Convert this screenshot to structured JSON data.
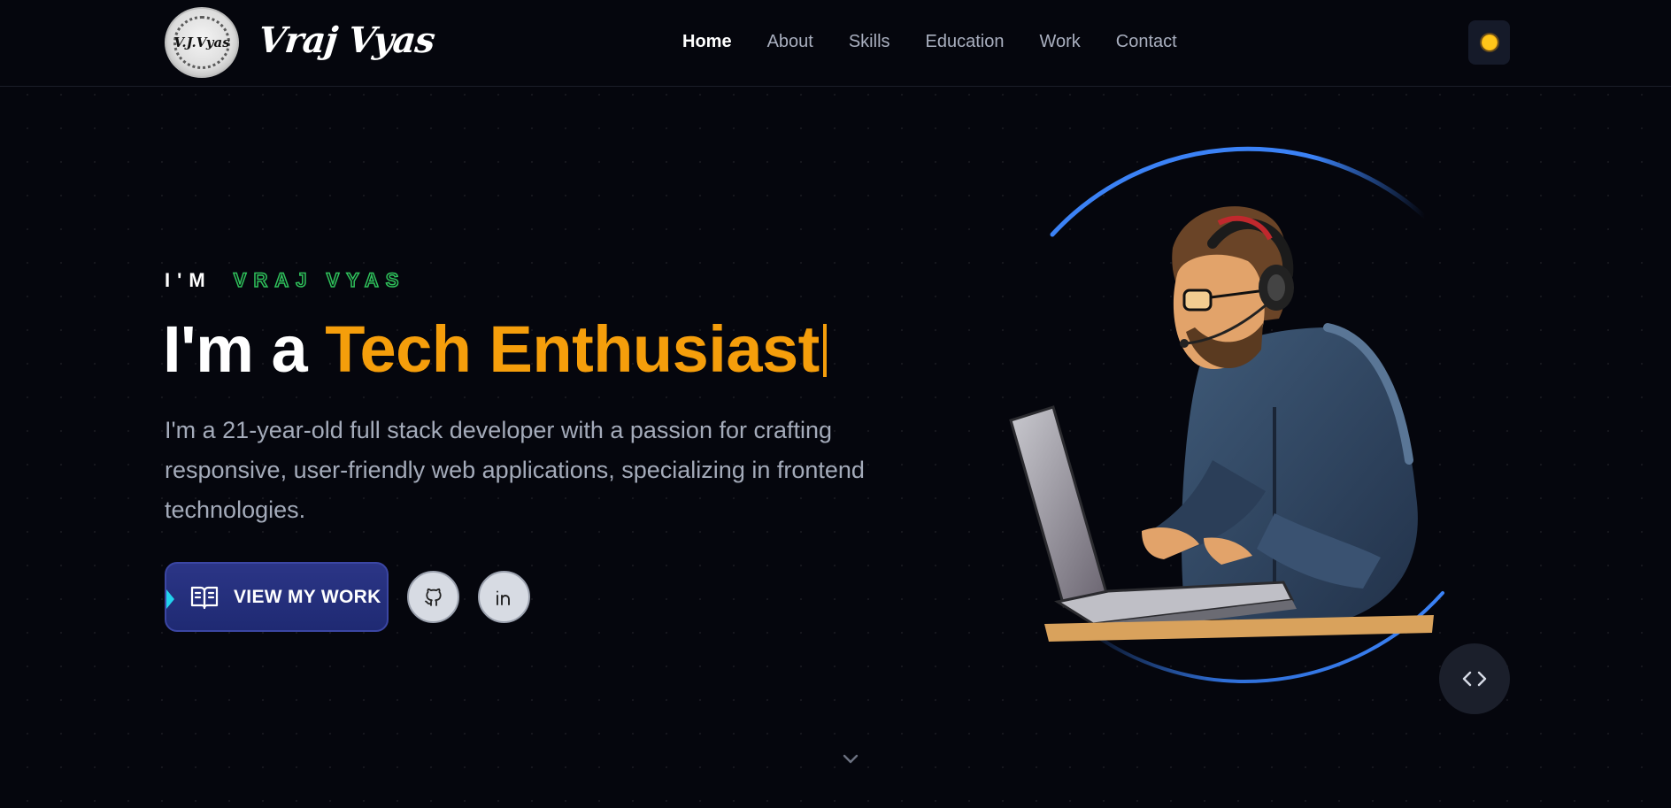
{
  "brand": {
    "monogram": "V.J.Vyas",
    "name": "Vraj Vyas"
  },
  "nav": {
    "items": [
      {
        "label": "Home",
        "active": true
      },
      {
        "label": "About",
        "active": false
      },
      {
        "label": "Skills",
        "active": false
      },
      {
        "label": "Education",
        "active": false
      },
      {
        "label": "Work",
        "active": false
      },
      {
        "label": "Contact",
        "active": false
      }
    ],
    "theme_icon": "sun-icon"
  },
  "hero": {
    "eyebrow_prefix": "I'M",
    "eyebrow_name": "VRAJ VYAS",
    "headline_prefix": "I'm a",
    "headline_role": "Tech Enthusiast",
    "intro": "I'm a 21-year-old full stack developer with a passion for crafting responsive, user-friendly web applications, specializing in frontend technologies.",
    "cta_label": "VIEW MY WORK",
    "cta_icon": "open-book-icon",
    "socials": [
      {
        "name": "github-icon"
      },
      {
        "name": "linkedin-icon"
      }
    ],
    "code_icon": "code-brackets-icon",
    "scroll_icon": "chevron-down-icon"
  },
  "colors": {
    "background": "#05060d",
    "accent_orange": "#f59e0b",
    "accent_green": "#2fc15b",
    "cta_blue": "#1f2a73",
    "ring_blue": "#3b82f6"
  }
}
